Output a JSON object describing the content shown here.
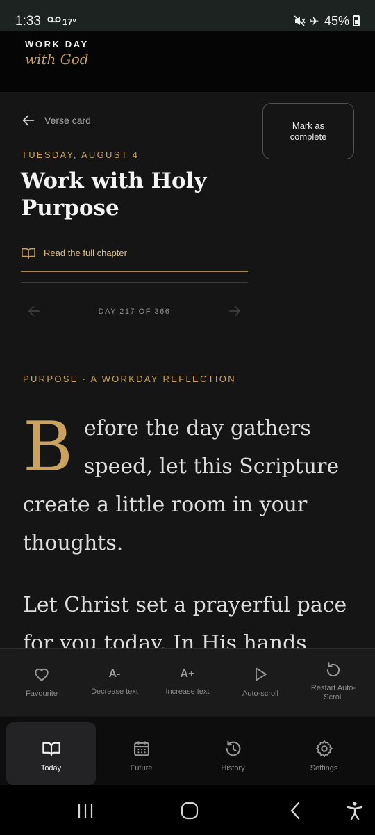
{
  "status_bar": {
    "time": "1:33",
    "temperature": "17°",
    "battery": "45%"
  },
  "app": {
    "brand_top": "WORK DAY",
    "brand_bottom": "with God"
  },
  "header": {
    "back_label": "Verse card",
    "mark_complete": "Mark as complete",
    "date": "TUESDAY, AUGUST 4",
    "title": "Work with Holy Purpose",
    "chapter_link": "Read the full chapter",
    "day_counter": "DAY 217 OF 366"
  },
  "reflection": {
    "eyebrow": "PURPOSE · A WORKDAY REFLECTION",
    "drop_cap": "B",
    "para1_rest": "efore the day gathers speed, let this Scripture create a little room in your thoughts.",
    "para2": "Let Christ set a prayerful pace for you today. In His hands"
  },
  "toolbar": {
    "favourite": "Favourite",
    "decrease_icon": "A-",
    "decrease": "Decrease text",
    "increase_icon": "A+",
    "increase": "Increase text",
    "autoscroll": "Auto-scroll",
    "restart": "Restart Auto-Scroll"
  },
  "nav": {
    "today": "Today",
    "future": "Future",
    "history": "History",
    "settings": "Settings"
  },
  "colors": {
    "accent": "#c9a25f",
    "background": "#151516",
    "header": "#050505"
  }
}
